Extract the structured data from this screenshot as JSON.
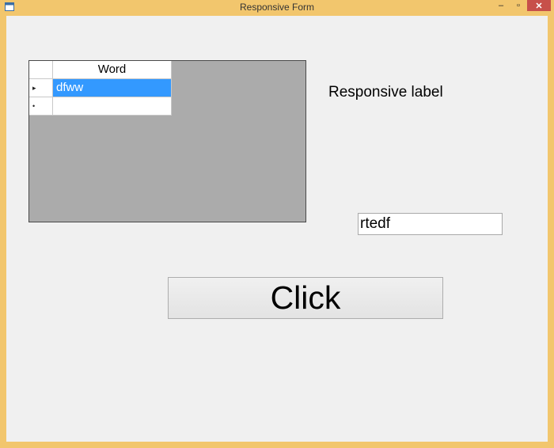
{
  "window": {
    "title": "Responsive Form",
    "controls": {
      "minimize": "–",
      "maximize": "▫",
      "close": "✕"
    }
  },
  "grid": {
    "column_header": "Word",
    "rows": [
      {
        "marker": "▸",
        "value": "dfww",
        "selected": true
      },
      {
        "marker": "•",
        "value": "",
        "selected": false
      }
    ]
  },
  "label": {
    "text": "Responsive label"
  },
  "textbox": {
    "value": "rtedf"
  },
  "button": {
    "label": "Click"
  },
  "colors": {
    "title_bar": "#f2c66d",
    "client": "#f0f0f0",
    "grid_background": "#ababab",
    "selection": "#3399ff",
    "close_button": "#c7504a"
  }
}
